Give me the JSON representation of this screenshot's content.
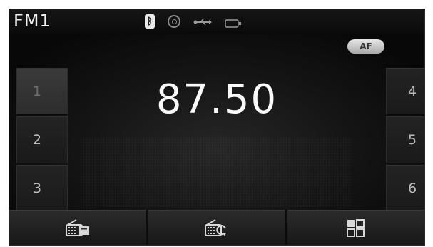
{
  "status": {
    "band": "FM1",
    "icons": [
      "bluetooth-icon",
      "disc-icon",
      "usb-icon",
      "aux-battery-icon"
    ]
  },
  "main": {
    "frequency": "87.50",
    "af_label": "AF"
  },
  "presets": {
    "left": [
      {
        "label": "1",
        "active": true
      },
      {
        "label": "2",
        "active": false
      },
      {
        "label": "3",
        "active": false
      }
    ],
    "right": [
      {
        "label": "4"
      },
      {
        "label": "5"
      },
      {
        "label": "6"
      }
    ]
  },
  "bottom": {
    "buttons": [
      "radio-list-icon",
      "radio-scan-icon",
      "menu-grid-icon"
    ]
  },
  "colors": {
    "background": "#0b0b0b",
    "text": "#fafafa",
    "preset_text": "#bdbdbd",
    "active_preset": "#3a3a3a",
    "af_badge": "#cfcfcf"
  }
}
